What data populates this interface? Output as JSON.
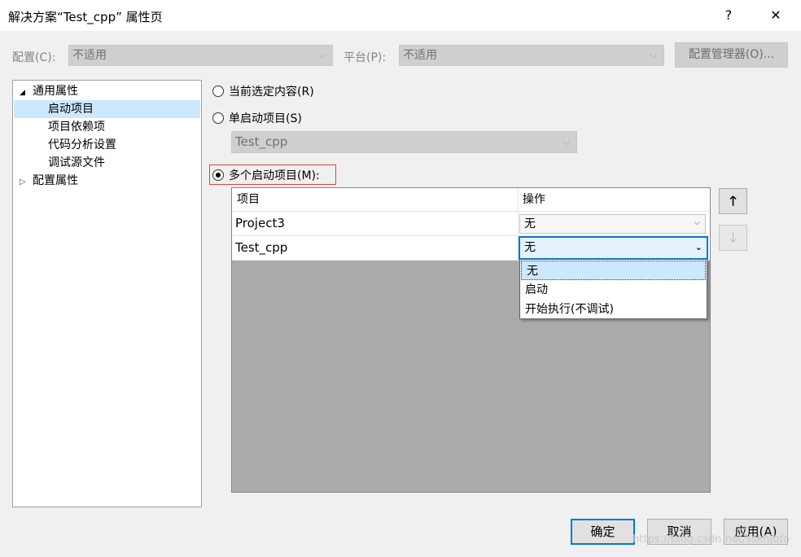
{
  "window": {
    "title": "解决方案“Test_cpp” 属性页",
    "help": "?",
    "close": "✕"
  },
  "config_bar": {
    "config_label": "配置(C):",
    "config_value": "不适用",
    "platform_label": "平台(P):",
    "platform_value": "不适用",
    "manager_button": "配置管理器(O)..."
  },
  "tree": {
    "items": [
      {
        "label": "通用属性",
        "expander": "◢"
      },
      {
        "label": "启动项目"
      },
      {
        "label": "项目依赖项"
      },
      {
        "label": "代码分析设置"
      },
      {
        "label": "调试源文件"
      },
      {
        "label": "配置属性",
        "expander": "▷"
      }
    ]
  },
  "options": {
    "current_selection": "当前选定内容(R)",
    "single_startup": "单启动项目(S)",
    "single_startup_value": "Test_cpp",
    "multiple_startup": "多个启动项目(M):"
  },
  "grid": {
    "headers": [
      "项目",
      "操作"
    ],
    "rows": [
      {
        "project": "Project3",
        "action": "无"
      },
      {
        "project": "Test_cpp",
        "action": "无"
      }
    ]
  },
  "dropdown": {
    "options": [
      "无",
      "启动",
      "开始执行(不调试)"
    ]
  },
  "side_buttons": {
    "up": "🡑",
    "down": "🡓"
  },
  "buttons": {
    "ok": "确定",
    "cancel": "取消",
    "apply": "应用(A)"
  },
  "watermark": "https://blog.csdn.net/sskhjbfo",
  "colors": {
    "highlight_red": "#e04343",
    "selection": "#cce8ff",
    "focus": "#0078d7"
  }
}
